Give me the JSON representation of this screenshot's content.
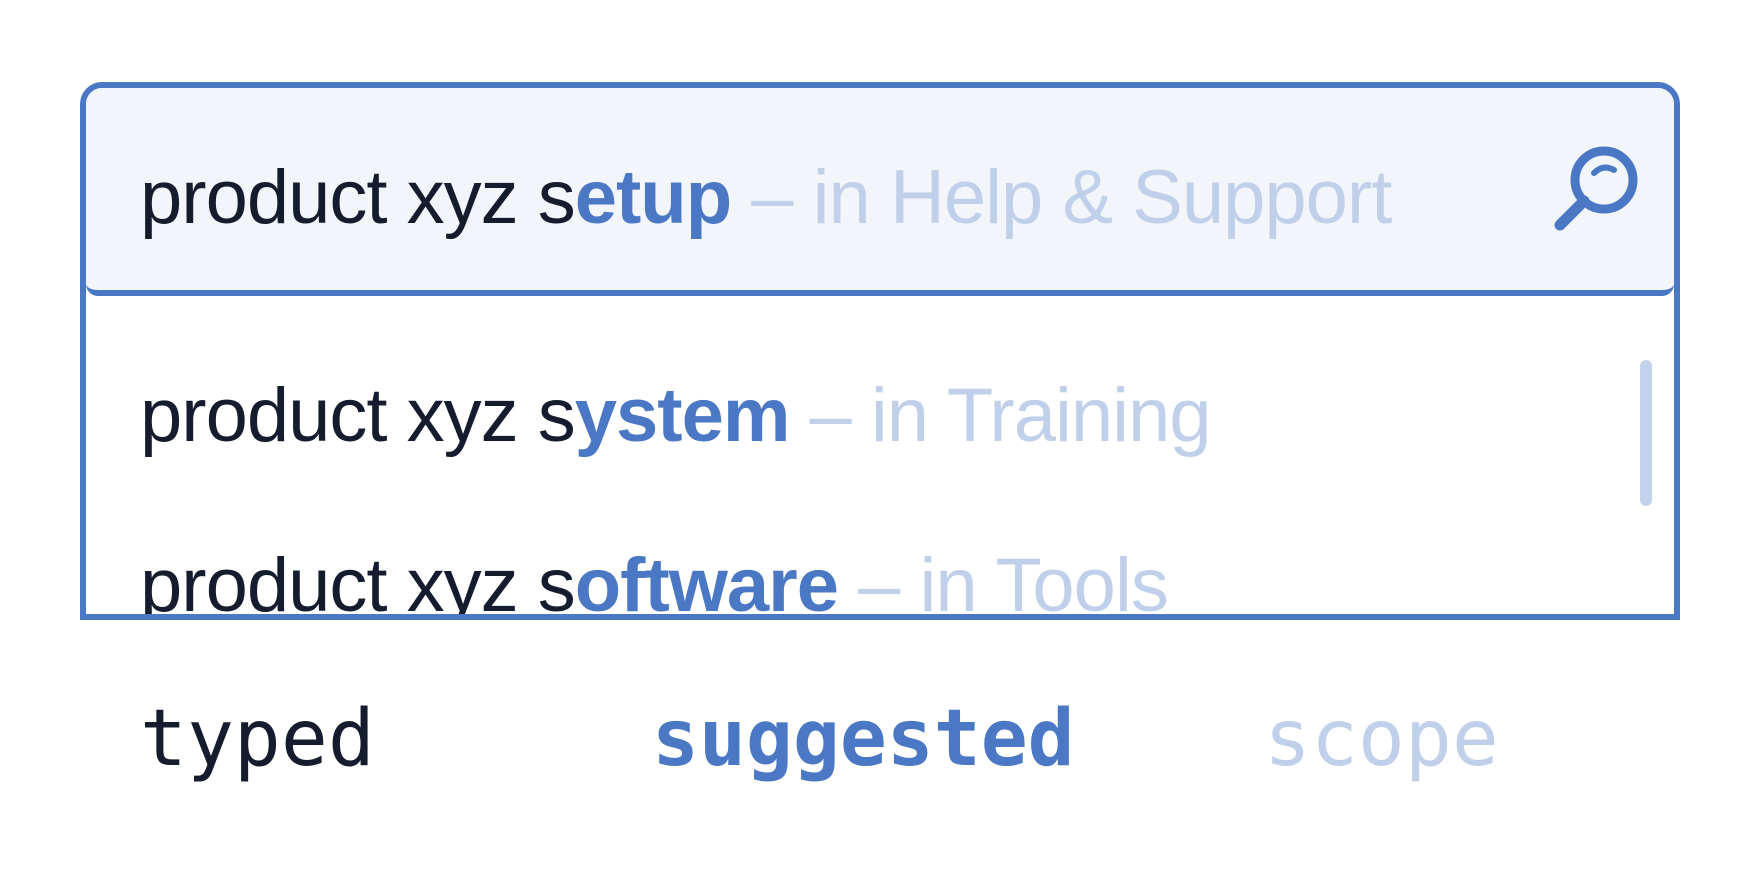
{
  "search": {
    "typed": "product xyz s",
    "suggested": "etup",
    "scope": " – in Help & Support",
    "icon": "search-icon"
  },
  "suggestions": [
    {
      "typed": "product xyz s",
      "suggested": "ystem",
      "scope": " – in Training"
    },
    {
      "typed": "product xyz s",
      "suggested": "oftware",
      "scope": " – in Tools"
    }
  ],
  "legend": {
    "typed": "typed",
    "suggested": "suggested",
    "scope": "scope"
  },
  "colors": {
    "accent": "#4a78c4",
    "typed": "#141c2e",
    "scope": "#c1d0ea",
    "field_background": "#f2f5fa"
  }
}
